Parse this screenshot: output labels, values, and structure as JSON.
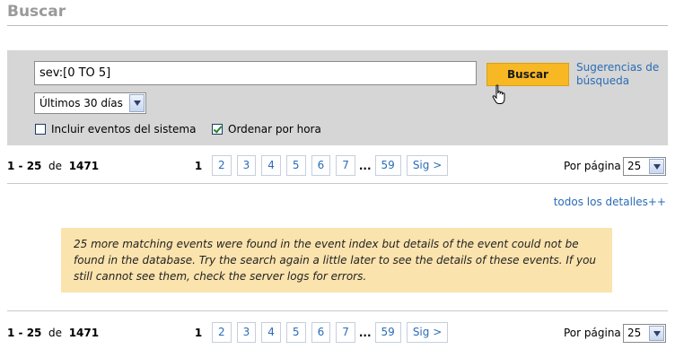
{
  "page": {
    "title": "Buscar"
  },
  "search": {
    "query": "sev:[0 TO 5]",
    "button_label": "Buscar",
    "suggestions_label": "Sugerencias de búsqueda",
    "time_range": "Últimos 30 días",
    "include_system_label": "Incluir eventos del sistema",
    "include_system_checked": false,
    "sort_by_time_label": "Ordenar por hora",
    "sort_by_time_checked": true
  },
  "pagination": {
    "range_start": "1",
    "range_sep": " - ",
    "range_end": "25",
    "of_label": "de",
    "total": "1471",
    "current_page": "1",
    "pages": [
      "2",
      "3",
      "4",
      "5",
      "6",
      "7"
    ],
    "ellipsis": "...",
    "last_page": "59",
    "next_label": "Sig >",
    "per_page_label": "Por página",
    "per_page_value": "25"
  },
  "details_link": "todos los detalles++",
  "notice": "25 more matching events were found in the event index but details of the event could not be found in the database. Try the search again a little later to see the details of these events. If you still cannot see them, check the server logs for errors.",
  "colors": {
    "accent": "#f7b824",
    "link": "#2a6cb6",
    "panel": "#d6d6d6",
    "notice": "#fbe3ad",
    "title": "#9a9a9a"
  }
}
